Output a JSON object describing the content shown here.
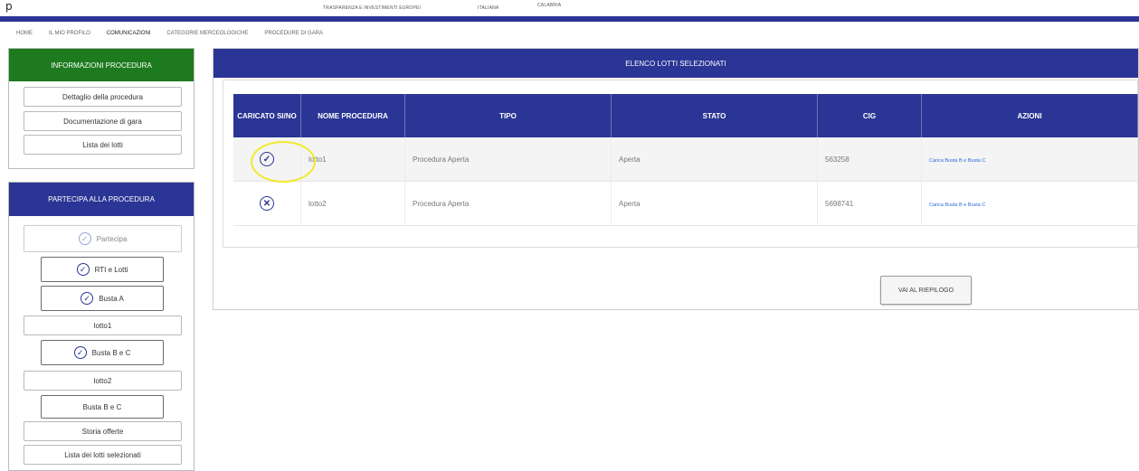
{
  "page_marker": "p",
  "header_texts": [
    "TRASPARENZA E INVESTIMENTI EUROPEI",
    "ITALIANA",
    "CALABRIA"
  ],
  "nav": [
    "HOME",
    "IL MIO PROFILO",
    "COMUNICAZIONI",
    "CATEGORIE MERCEOLOGICHE",
    "PROCEDURE DI GARA"
  ],
  "sidebar": {
    "info_title": "INFORMAZIONI PROCEDURA",
    "info_items": [
      "Dettaglio della procedura",
      "Documentazione di gara",
      "Lista dei lotti"
    ],
    "partecipa_title": "PARTECIPA ALLA PROCEDURA",
    "partecipa_label": "Partecipa",
    "rti_label": "RTI e Lotti",
    "busta_a_label": "Busta A",
    "lotto1_label": "lotto1",
    "busta_bc1_label": "Busta B e C",
    "lotto2_label": "lotto2",
    "busta_bc2_label": "Busta B e C",
    "storia_label": "Storia offerte",
    "lista_label": "Lista dei lotti selezionati"
  },
  "main": {
    "title": "ELENCO LOTTI SELEZIONATI",
    "columns": [
      "CARICATO SI/NO",
      "NOME PROCEDURA",
      "TIPO",
      "STATO",
      "CIG",
      "AZIONI"
    ],
    "rows": [
      {
        "status": "check-icon",
        "name": "lotto1",
        "tipo": "Procedura Aperta",
        "stato": "Aperta",
        "cig": "563258",
        "azione": "Carica Busta B e Busta C"
      },
      {
        "status": "close-icon",
        "name": "lotto2",
        "tipo": "Procedura Aperta",
        "stato": "Aperta",
        "cig": "5698741",
        "azione": "Carica Busta B e Busta C"
      }
    ],
    "riepilogo_label": "VAI AL RIEPILOGO"
  },
  "colors": {
    "primary_blue": "#2a3595",
    "green_header": "#1e7a1e",
    "highlight": "#f2e92c",
    "link": "#2a6bd8"
  }
}
